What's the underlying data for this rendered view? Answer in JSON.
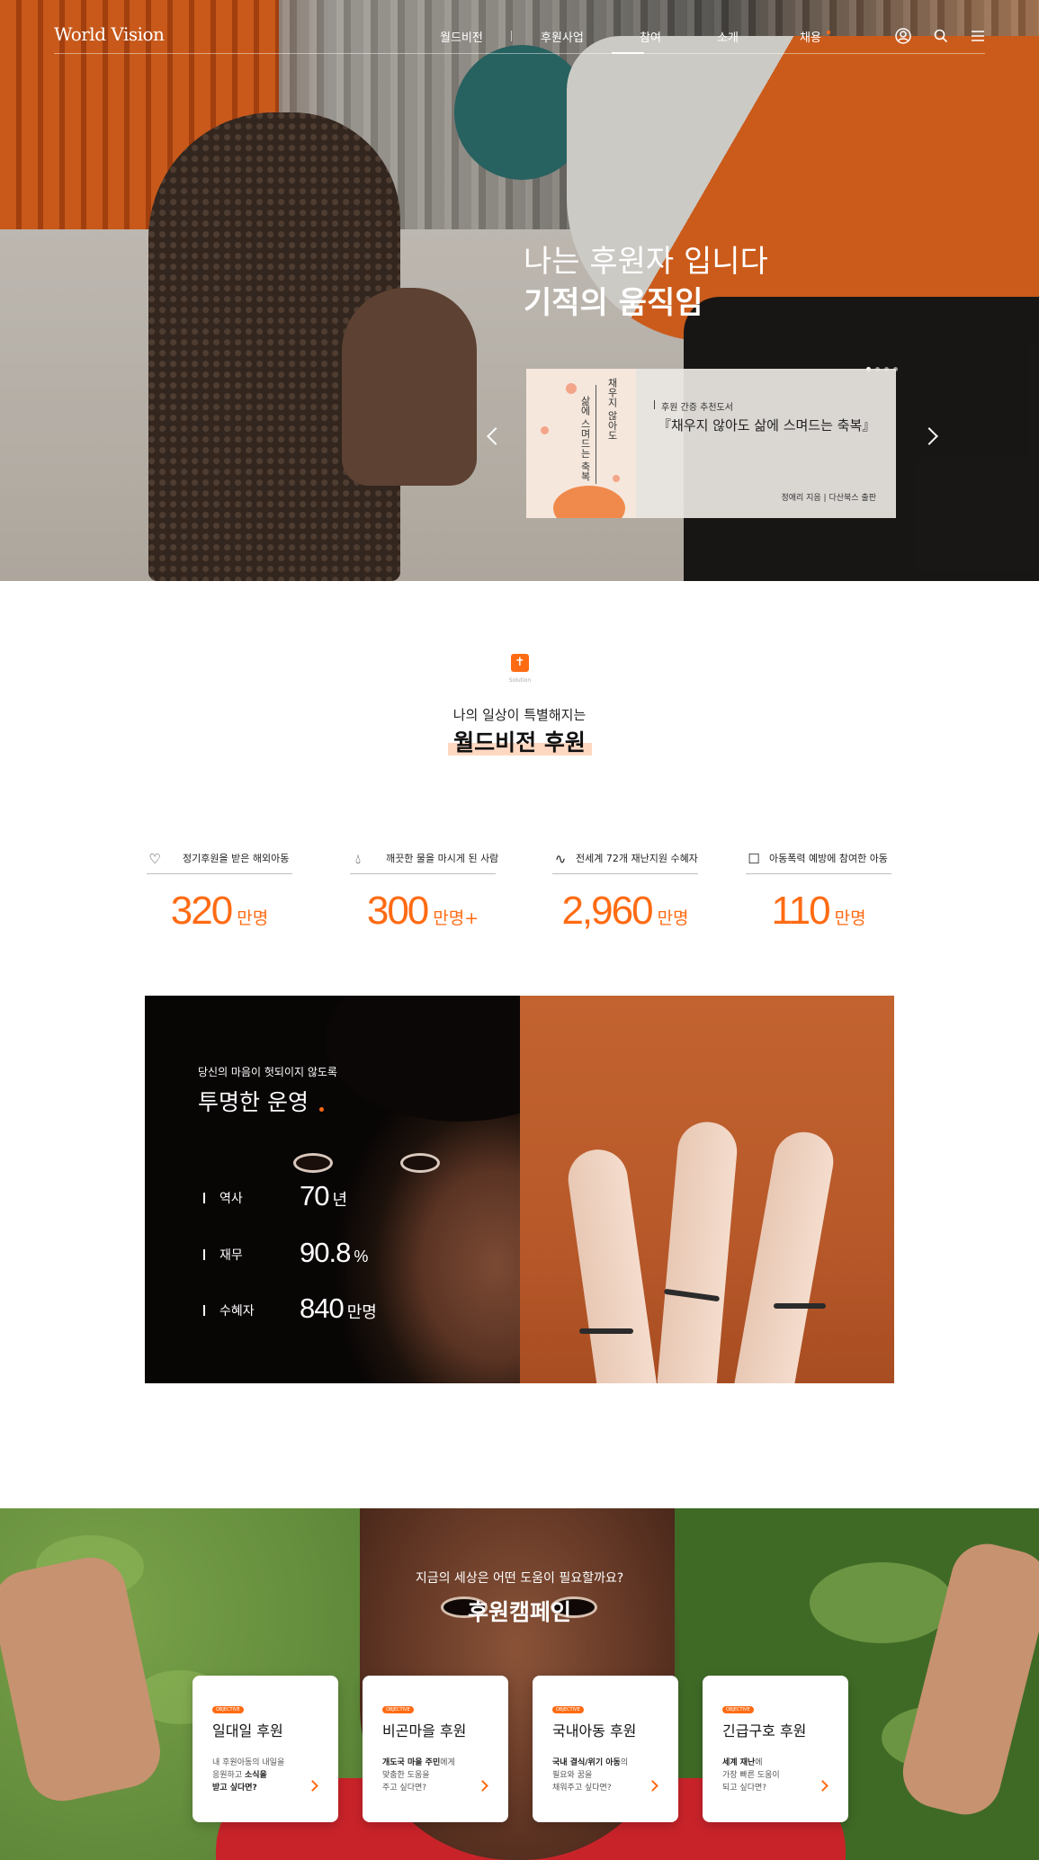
{
  "header": {
    "logo": "World Vision",
    "menu": [
      {
        "label": "월드비전"
      },
      {
        "label": "후원사업"
      },
      {
        "label": "참여"
      },
      {
        "label": "소개"
      },
      {
        "label": "채용"
      }
    ],
    "icons": [
      "user-icon",
      "search-icon",
      "hamburger-menu-icon"
    ]
  },
  "hero": {
    "title_line1": "나는 후원자 입니다",
    "title_line2": "기적의 움직임",
    "slide_count": 4,
    "active_slide": 1,
    "book": {
      "cover_title_1": "채우지 않아도",
      "cover_title_2": "삶에 스며드는 축복",
      "tag": "후원 간증 추천도서",
      "title": "『채우지 않아도 삶에 스며드는 축복』",
      "publisher": "정애리 지음 | 다산북스 출판"
    }
  },
  "solution": {
    "badge_icon": "cross-icon",
    "badge_label": "Solution",
    "subtitle": "나의 일상이 특별해지는",
    "title": "월드비전 후원",
    "stats": [
      {
        "icon": "heart-hand-icon",
        "label": "정기후원을 받은 해외아동",
        "value": "320",
        "unit": "만명"
      },
      {
        "icon": "water-drop-icon",
        "label": "깨끗한 물을 마시게 된 사람",
        "value": "300",
        "unit": "만명+"
      },
      {
        "icon": "pulse-icon",
        "label": "전세계 72개 재난지원 수혜자",
        "value": "2,960",
        "unit": "만명"
      },
      {
        "icon": "child-id-icon",
        "label": "아동폭력 예방에 참여한 아동",
        "value": "110",
        "unit": "만명"
      }
    ]
  },
  "transparency": {
    "subtitle": "당신의 마음이 헛되이지 않도록",
    "title": "투명한 운영",
    "rows": [
      {
        "label": "역사",
        "value": "70",
        "unit": "년"
      },
      {
        "label": "재무",
        "value": "90.8",
        "unit": "%"
      },
      {
        "label": "수혜자",
        "value": "840",
        "unit": "만명"
      }
    ]
  },
  "campaign": {
    "subtitle": "지금의 세상은 어떤 도움이 필요할까요?",
    "title": "후원캠페인",
    "cards": [
      {
        "badge": "OBJECTIVE",
        "title": "일대일 후원",
        "desc_a": "내 후원아동의 내일을",
        "desc_b": "응원하고 ",
        "desc_b_bold": "소식을",
        "desc_c_bold": "받고 싶다면?"
      },
      {
        "badge": "OBJECTIVE",
        "title": "비곤마을 후원",
        "desc_a_bold": "개도국 마을 주민",
        "desc_a": "에게",
        "desc_b": "맞춤한 도움을",
        "desc_c": "주고 싶다면?"
      },
      {
        "badge": "OBJECTIVE",
        "title": "국내아동 후원",
        "desc_a_bold": "국내 결식/위기 아동",
        "desc_a": "의",
        "desc_b": "필요와 꿈을",
        "desc_c": "채워주고 싶다면?"
      },
      {
        "badge": "OBJECTIVE",
        "title": "긴급구호 후원",
        "desc_a_bold": "세계 재난",
        "desc_a": "에",
        "desc_b": "가장 빠른 도움이",
        "desc_c": "되고 싶다면?"
      }
    ]
  },
  "colors": {
    "accent": "#ff6b13",
    "highlight": "#ffd8c2",
    "text": "#222222"
  }
}
